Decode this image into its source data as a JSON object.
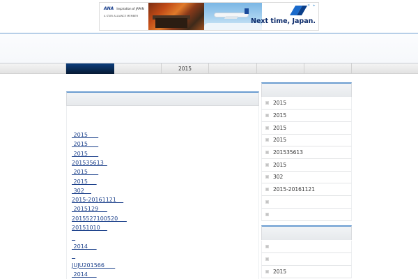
{
  "ad": {
    "brand_logo": "ANA",
    "brand_tagline": "Inspiration of JAPAN",
    "brand_member": "A STAR ALLIANCE MEMBER",
    "headline": "Next time, Japan.",
    "choices_icon": "adchoices-icon",
    "close_icon": "close-icon"
  },
  "colors": {
    "accent": "#6a9cd0",
    "nav_active": "#0c3d7c",
    "link": "#1a3f8a"
  },
  "nav": {
    "items": [
      "",
      "",
      "2015",
      "",
      "",
      ""
    ]
  },
  "main": {
    "posts": [
      " 2015      ",
      " 2015      ",
      " 2015      ",
      "201535613  ",
      " 2015      ",
      " 2015     ",
      " 302    ",
      "2015-20161121    ",
      " 2015129     ",
      "2015527100520     ",
      "20151010    ",
      "  ",
      " 2014     ",
      "  ",
      "JUJU201566      ",
      " 2014     "
    ]
  },
  "sidebar": {
    "section1_items": [
      "2015",
      "2015",
      "2015",
      "2015",
      "201535613",
      "2015",
      "302",
      "2015-20161121",
      "",
      ""
    ],
    "section2_items": [
      "",
      "",
      "2015"
    ]
  }
}
